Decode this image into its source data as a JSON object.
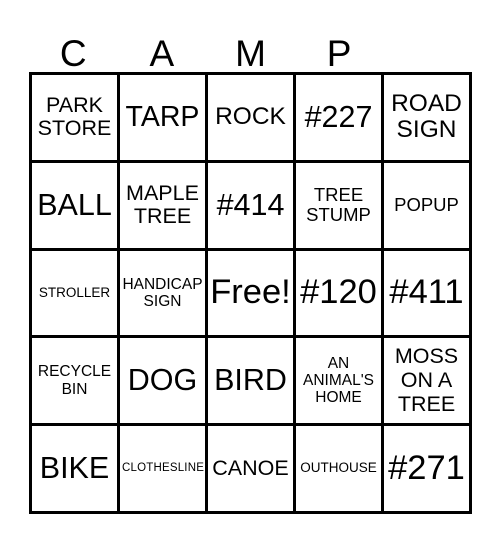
{
  "card": {
    "title_letters": [
      "C",
      "A",
      "M",
      "P",
      ""
    ],
    "colors": {
      "grid_line": "#000000",
      "text": "#000000",
      "background": "#ffffff"
    },
    "rows": [
      [
        {
          "text": "PARK\nSTORE",
          "size": "fs-21"
        },
        {
          "text": "TARP",
          "size": "fs-28"
        },
        {
          "text": "ROCK",
          "size": "fs-24"
        },
        {
          "text": "#227",
          "size": "fs-30"
        },
        {
          "text": "ROAD\nSIGN",
          "size": "fs-24"
        }
      ],
      [
        {
          "text": "BALL",
          "size": "fs-30"
        },
        {
          "text": "MAPLE\nTREE",
          "size": "fs-21"
        },
        {
          "text": "#414",
          "size": "fs-30"
        },
        {
          "text": "TREE\nSTUMP",
          "size": "fs-18"
        },
        {
          "text": "POPUP",
          "size": "fs-18"
        }
      ],
      [
        {
          "text": "STROLLER",
          "size": "fs-13"
        },
        {
          "text": "HANDICAP\nSIGN",
          "size": "fs-15"
        },
        {
          "text": "Free!",
          "size": "fs-34"
        },
        {
          "text": "#120",
          "size": "fs-34"
        },
        {
          "text": "#411",
          "size": "fs-34"
        }
      ],
      [
        {
          "text": "RECYCLE\nBIN",
          "size": "fs-15"
        },
        {
          "text": "DOG",
          "size": "fs-30"
        },
        {
          "text": "BIRD",
          "size": "fs-30"
        },
        {
          "text": "AN\nANIMAL'S\nHOME",
          "size": "fs-15"
        },
        {
          "text": "MOSS\nON A\nTREE",
          "size": "fs-21"
        }
      ],
      [
        {
          "text": "BIKE",
          "size": "fs-30"
        },
        {
          "text": "CLOTHESLINE",
          "size": "fs-11"
        },
        {
          "text": "CANOE",
          "size": "fs-21"
        },
        {
          "text": "OUTHOUSE",
          "size": "fs-13"
        },
        {
          "text": "#271",
          "size": "fs-34"
        }
      ]
    ]
  }
}
